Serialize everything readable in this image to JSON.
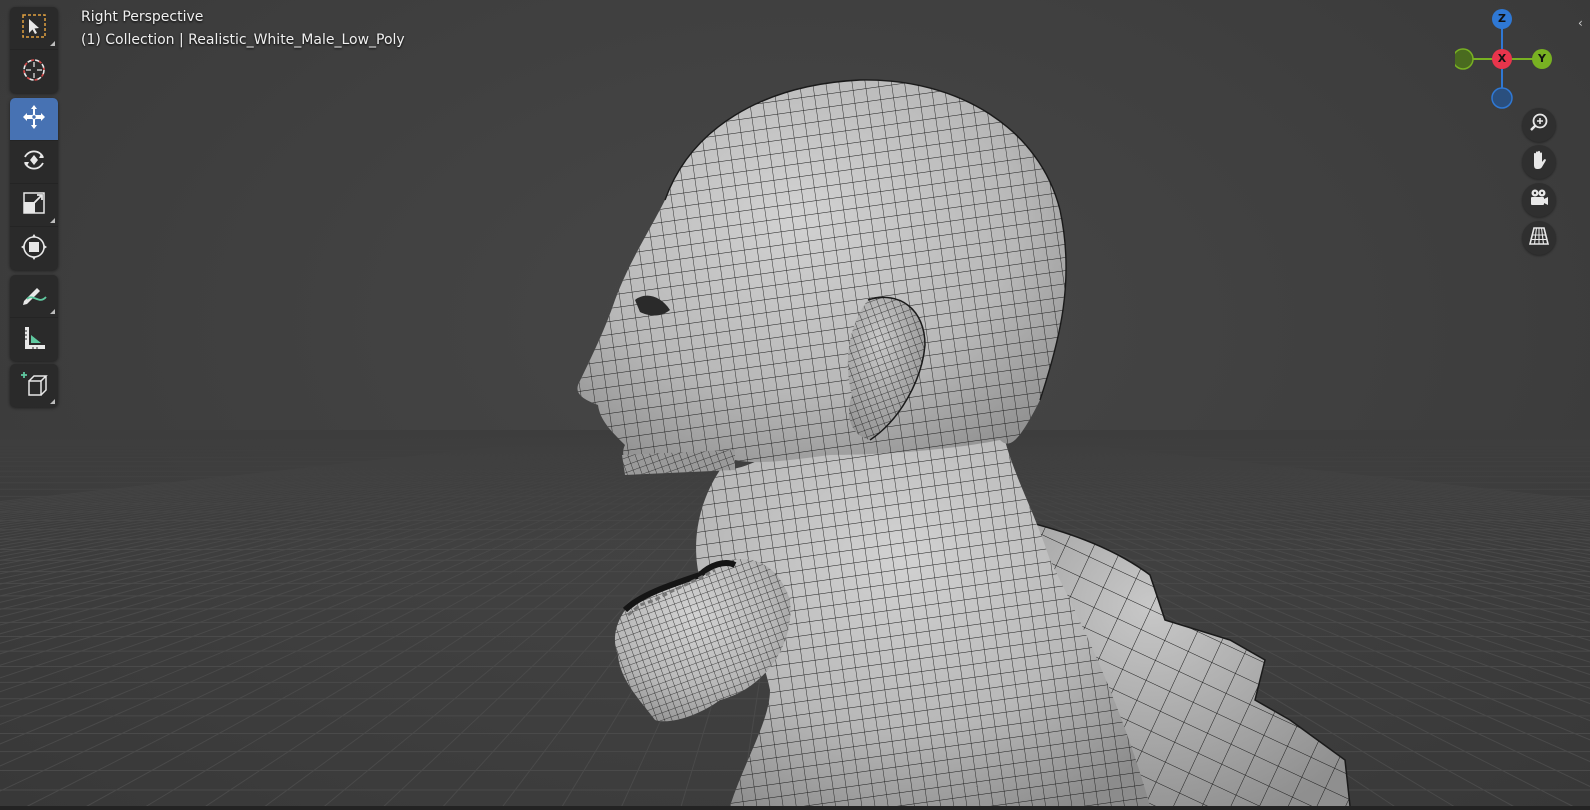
{
  "viewport": {
    "view_name": "Right Perspective",
    "collection_info": "(1) Collection | Realistic_White_Male_Low_Poly",
    "background_color": "#3d3d3d"
  },
  "toolbar": {
    "groups": [
      [
        {
          "name": "select-box-tool",
          "icon": "select-box-icon"
        },
        {
          "name": "cursor-tool",
          "icon": "cursor-icon"
        }
      ],
      [
        {
          "name": "move-tool",
          "icon": "move-icon",
          "active": true
        },
        {
          "name": "rotate-tool",
          "icon": "rotate-icon"
        },
        {
          "name": "scale-tool",
          "icon": "scale-icon"
        },
        {
          "name": "transform-tool",
          "icon": "transform-icon"
        }
      ],
      [
        {
          "name": "annotate-tool",
          "icon": "annotate-icon"
        },
        {
          "name": "measure-tool",
          "icon": "measure-icon"
        }
      ],
      [
        {
          "name": "add-cube-tool",
          "icon": "add-cube-icon"
        }
      ]
    ],
    "active_color": "#4772b3"
  },
  "navigation_gizmo": {
    "axes": {
      "z": "Z",
      "x": "X",
      "y": "Y"
    },
    "colors": {
      "z": "#2f78d4",
      "x": "#e8354c",
      "y": "#78b122"
    }
  },
  "nav_buttons": [
    {
      "name": "zoom-button",
      "icon": "zoom-icon"
    },
    {
      "name": "pan-button",
      "icon": "hand-icon"
    },
    {
      "name": "camera-view-button",
      "icon": "camera-icon"
    },
    {
      "name": "ortho-toggle-button",
      "icon": "grid-icon"
    }
  ],
  "mesh": {
    "name": "Realistic_White_Male_Low_Poly",
    "display": "wireframe-over-solid",
    "surface_color": "#b5b5b5",
    "wire_color": "#1e1e1e"
  }
}
